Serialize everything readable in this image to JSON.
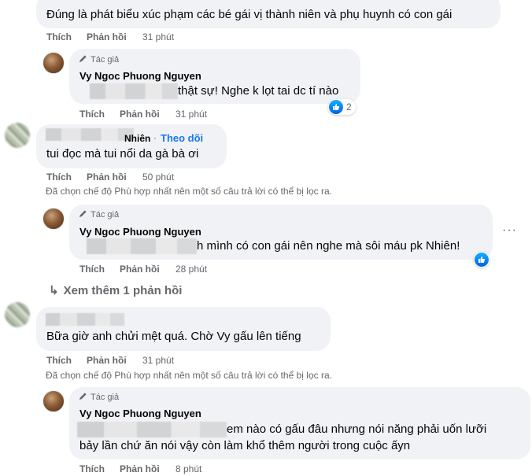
{
  "colors": {
    "bubble": "#f0f2f5",
    "meta": "#65676b",
    "accent": "#1877f2",
    "like": "#0062df"
  },
  "comment1": {
    "text": "Đúng là phát biểu xúc phạm các bé gái vị thành niên và phụ huynh có con gái",
    "like": "Thích",
    "reply": "Phản hồi",
    "time": "31 phút"
  },
  "reply1": {
    "badge": "Tác giả",
    "author": "Vy Ngoc Phuong Nguyen",
    "text": "thật sự! Nghe k lọt tai dc tí nào",
    "reactions": "2",
    "like": "Thích",
    "reply": "Phản hồi",
    "time": "31 phút"
  },
  "comment2": {
    "author_partial": "Nhiên",
    "dot": "·",
    "follow": "Theo dõi",
    "text": "tui đọc mà tui nổi da gà bà ơi",
    "like": "Thích",
    "reply": "Phản hồi",
    "time": "50 phút",
    "filter_note": "Đã chọn chế độ Phù hợp nhất nên một số câu trả lời có thể bị lọc ra."
  },
  "reply2": {
    "badge": "Tác giả",
    "author": "Vy Ngoc Phuong Nguyen",
    "text": "h mình có con gái nên nghe mà sôi máu pk Nhiên!",
    "more": "···",
    "like": "Thích",
    "reply": "Phản hồi",
    "time": "28 phút"
  },
  "view_more": {
    "arrow": "↳",
    "label": "Xem thêm 1 phản hồi"
  },
  "comment3": {
    "text": "Bữa giờ anh chửi mệt quá. Chờ Vy gấu lên tiếng",
    "like": "Thích",
    "reply": "Phản hồi",
    "time": "31 phút",
    "filter_note": "Đã chọn chế độ Phù hợp nhất nên một số câu trả lời có thể bị lọc ra."
  },
  "reply3": {
    "badge": "Tác giả",
    "author": "Vy Ngoc Phuong Nguyen",
    "text_line1": "em nào có gấu đâu nhưng nói năng phải uốn lưỡi",
    "text_line2": "bảy lần chứ ăn nói vậy còn làm khổ thêm người trong cuộc ấyn",
    "like": "Thích",
    "reply": "Phản hồi",
    "time": "8 phút"
  }
}
